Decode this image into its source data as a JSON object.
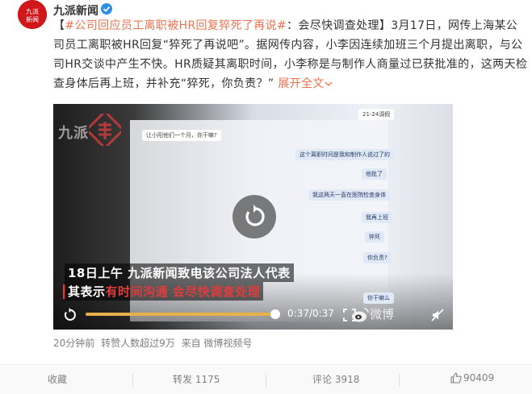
{
  "account": {
    "name": "九派新闻",
    "avatar_text": "九派 新闻"
  },
  "post": {
    "topic": "#公司回应员工离职被HR回复猝死了再说#",
    "body": "：会尽快调查处理】3月17日，网传上海某公司员工离职被HR回复“猝死了再说吧”。据网传内容，小李因连续加班三个月提出离职，与公司HR交谈中产生不快。HR质疑其离职时间，小李称是与制作人商量过已获批准的，这两天检查身体后再上班，并补充“猝死，你负责？”",
    "prefix": "【",
    "expand_label": "展开全文"
  },
  "video": {
    "watermark": "九派",
    "chat_lines": [
      "21-24调假",
      "让小阳他们一个月，你干嘛?",
      "这个离职时间是我和制作人说过了的",
      "他批了",
      "我这两天一直在医院检查身体",
      "我再上班",
      "猝死",
      "你负责?",
      "你干嘛么"
    ],
    "subtitle_line1": "18日上午 九派新闻致电该公司法人代表",
    "subtitle_line2_white": "其表示",
    "subtitle_line2_red": "有时间沟通 会尽快调查处理",
    "progress": 1.0,
    "time": "0:37/0:37",
    "weibo_watermark": "微博"
  },
  "meta": {
    "time_ago": "20分钟前",
    "reposts_note": "转赞人数超过9万",
    "source": "来自 微博视频号"
  },
  "actions": {
    "favorite": "收藏",
    "repost": "转发 1175",
    "comment": "评论 3918",
    "like": "90409"
  },
  "colors": {
    "brand_red": "#d0171b",
    "link_orange": "#eb7350",
    "progress": "#e8b048",
    "verify_blue": "#2f8de4"
  }
}
